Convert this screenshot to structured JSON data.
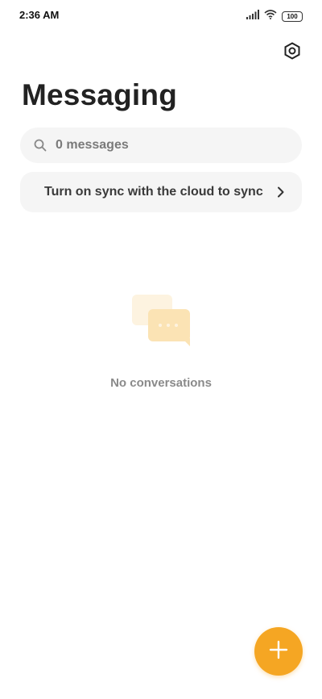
{
  "status_bar": {
    "time": "2:36 AM",
    "battery_level": "100",
    "icons": [
      "signal-icon",
      "wifi-icon",
      "battery-icon"
    ]
  },
  "header": {
    "title": "Messaging",
    "settings_icon": "settings-hexagon-icon"
  },
  "search": {
    "placeholder": "0 messages",
    "icon": "search-icon"
  },
  "sync_banner": {
    "text": "Turn on sync with the cloud to sync",
    "icon": "chevron-right-icon"
  },
  "empty_state": {
    "illustration": "chat-bubbles-icon",
    "text": "No conversations"
  },
  "fab": {
    "icon": "plus-icon",
    "color": "#F5A623"
  }
}
